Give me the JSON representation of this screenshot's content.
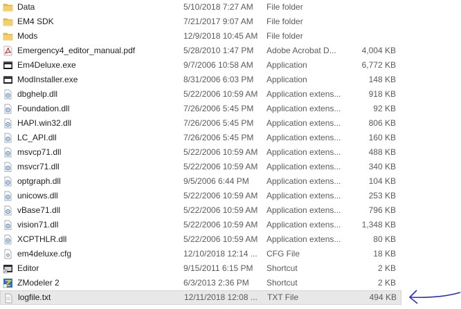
{
  "files": [
    {
      "name": "Data",
      "date": "5/10/2018 7:27 AM",
      "type": "File folder",
      "size": "",
      "icon": "folder-icon"
    },
    {
      "name": "EM4 SDK",
      "date": "7/21/2017 9:07 AM",
      "type": "File folder",
      "size": "",
      "icon": "folder-icon"
    },
    {
      "name": "Mods",
      "date": "12/9/2018 10:45 AM",
      "type": "File folder",
      "size": "",
      "icon": "folder-icon"
    },
    {
      "name": "Emergency4_editor_manual.pdf",
      "date": "5/28/2010 1:47 PM",
      "type": "Adobe Acrobat D...",
      "size": "4,004 KB",
      "icon": "pdf-icon"
    },
    {
      "name": "Em4Deluxe.exe",
      "date": "9/7/2006 10:58 AM",
      "type": "Application",
      "size": "6,772 KB",
      "icon": "exe-icon"
    },
    {
      "name": "ModInstaller.exe",
      "date": "8/31/2006 6:03 PM",
      "type": "Application",
      "size": "148 KB",
      "icon": "exe-icon"
    },
    {
      "name": "dbghelp.dll",
      "date": "5/22/2006 10:59 AM",
      "type": "Application extens...",
      "size": "918 KB",
      "icon": "dll-icon"
    },
    {
      "name": "Foundation.dll",
      "date": "7/26/2006 5:45 PM",
      "type": "Application extens...",
      "size": "92 KB",
      "icon": "dll-icon"
    },
    {
      "name": "HAPI.win32.dll",
      "date": "7/26/2006 5:45 PM",
      "type": "Application extens...",
      "size": "806 KB",
      "icon": "dll-icon"
    },
    {
      "name": "LC_API.dll",
      "date": "7/26/2006 5:45 PM",
      "type": "Application extens...",
      "size": "160 KB",
      "icon": "dll-icon"
    },
    {
      "name": "msvcp71.dll",
      "date": "5/22/2006 10:59 AM",
      "type": "Application extens...",
      "size": "488 KB",
      "icon": "dll-icon"
    },
    {
      "name": "msvcr71.dll",
      "date": "5/22/2006 10:59 AM",
      "type": "Application extens...",
      "size": "340 KB",
      "icon": "dll-icon"
    },
    {
      "name": "optgraph.dll",
      "date": "9/5/2006 6:44 PM",
      "type": "Application extens...",
      "size": "104 KB",
      "icon": "dll-icon"
    },
    {
      "name": "unicows.dll",
      "date": "5/22/2006 10:59 AM",
      "type": "Application extens...",
      "size": "253 KB",
      "icon": "dll-icon"
    },
    {
      "name": "vBase71.dll",
      "date": "5/22/2006 10:59 AM",
      "type": "Application extens...",
      "size": "796 KB",
      "icon": "dll-icon"
    },
    {
      "name": "vision71.dll",
      "date": "5/22/2006 10:59 AM",
      "type": "Application extens...",
      "size": "1,348 KB",
      "icon": "dll-icon"
    },
    {
      "name": "XCPTHLR.dll",
      "date": "5/22/2006 10:59 AM",
      "type": "Application extens...",
      "size": "80 KB",
      "icon": "dll-icon"
    },
    {
      "name": "em4deluxe.cfg",
      "date": "12/10/2018 12:14 ...",
      "type": "CFG File",
      "size": "18 KB",
      "icon": "cfg-icon"
    },
    {
      "name": "Editor",
      "date": "9/15/2011 6:15 PM",
      "type": "Shortcut",
      "size": "2 KB",
      "icon": "shortcut-icon"
    },
    {
      "name": "ZModeler 2",
      "date": "6/3/2013 2:36 PM",
      "type": "Shortcut",
      "size": "2 KB",
      "icon": "zmodeler-icon"
    },
    {
      "name": "logfile.txt",
      "date": "12/11/2018 12:08 ...",
      "type": "TXT File",
      "size": "494 KB",
      "icon": "txt-icon",
      "selected": true
    }
  ],
  "annotation": {
    "icon": "arrow-icon",
    "color": "#2a2ad0"
  }
}
